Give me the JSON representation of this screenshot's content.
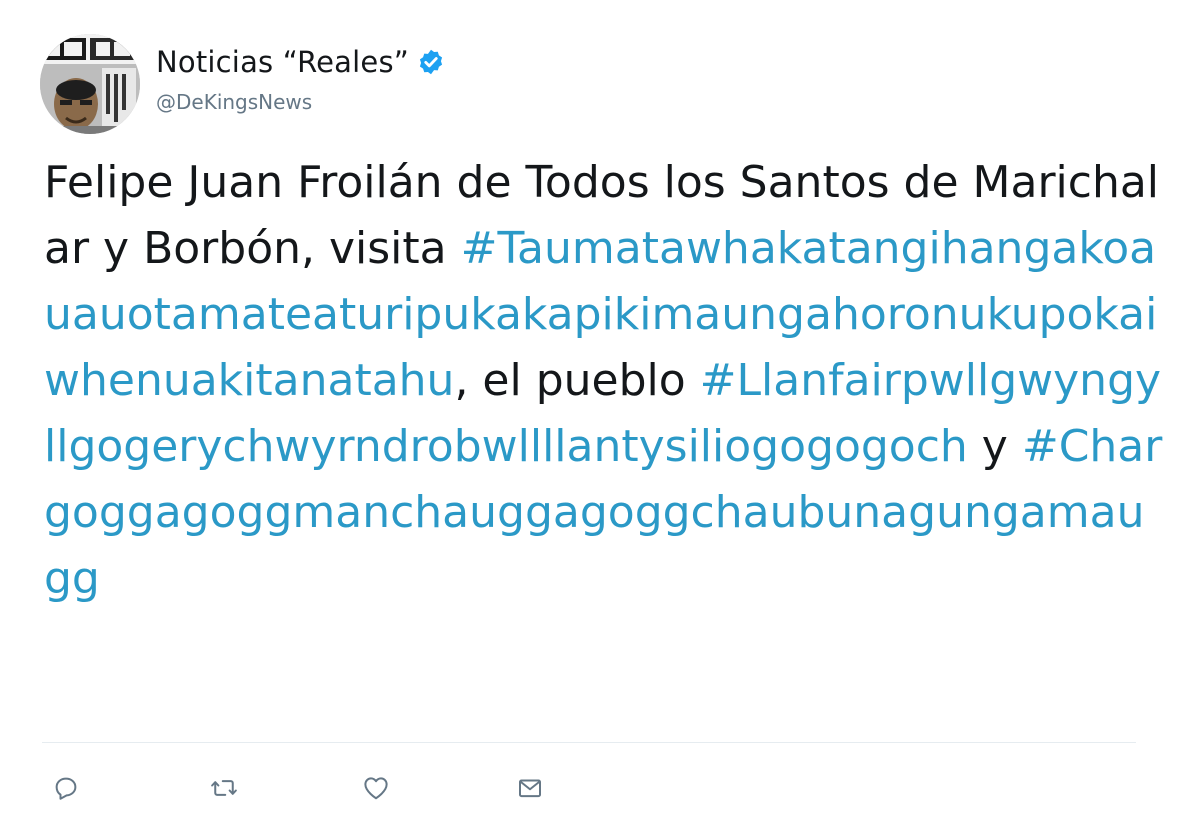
{
  "account": {
    "display_name": "Noticias “Reales”",
    "handle": "@DeKingsNews",
    "verified_icon": "verified-badge-icon",
    "avatar_icon": "avatar-newspaper-photo"
  },
  "tweet": {
    "segments": [
      {
        "type": "text",
        "text": "Felipe Juan Froilán de Todos los Santos de Marichalar y Borbón, visita "
      },
      {
        "type": "hashtag",
        "text": "#Taumatawhakatangihangakoauauotamateaturipukakapikimaungahoronukupokaiwhenuakitanatahu"
      },
      {
        "type": "text",
        "text": ", el pueblo "
      },
      {
        "type": "hashtag",
        "text": "#Llanfairpwllgwyngyllgogerychwyrndrobwllllantysiliogogogoch"
      },
      {
        "type": "text",
        "text": " y "
      },
      {
        "type": "hashtag",
        "text": "#Chargoggagoggmanchauggagoggchaubunagungamaugg"
      }
    ]
  },
  "actions": [
    {
      "name": "reply-button",
      "icon": "reply-icon"
    },
    {
      "name": "retweet-button",
      "icon": "retweet-icon"
    },
    {
      "name": "like-button",
      "icon": "heart-icon"
    },
    {
      "name": "direct-message-button",
      "icon": "envelope-icon"
    }
  ],
  "colors": {
    "text": "#14171a",
    "secondary": "#657786",
    "hashtag": "#2b99c7",
    "verified": "#1da1f2",
    "icon": "#657786",
    "divider": "#e6ecf0"
  }
}
